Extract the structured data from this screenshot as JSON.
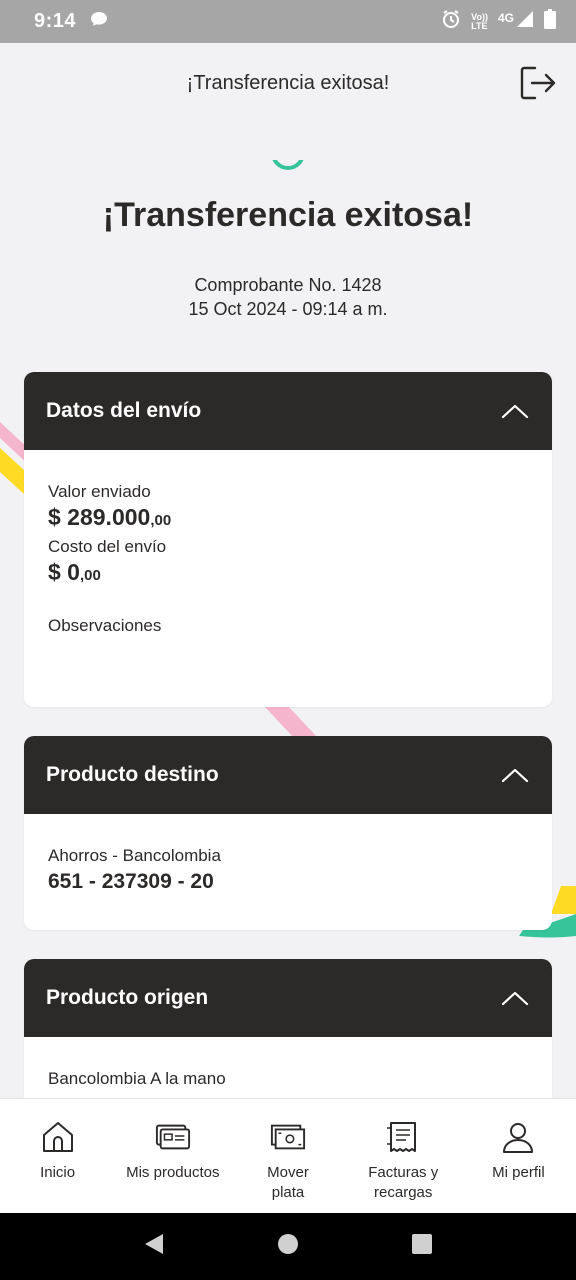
{
  "status_bar": {
    "time": "9:14",
    "volte_top": "Vo))",
    "volte_bottom": "LTE",
    "network": "4G"
  },
  "header": {
    "title": "¡Transferencia exitosa!"
  },
  "success": {
    "title": "¡Transferencia exitosa!",
    "receipt_line": "Comprobante No. 1428",
    "datetime": "15 Oct 2024 - 09:14 a m."
  },
  "envio": {
    "title": "Datos del envío",
    "valor_label": "Valor enviado",
    "valor_main": "$ 289.000",
    "valor_cents": ",00",
    "costo_label": "Costo del envío",
    "costo_main": "$ 0",
    "costo_cents": ",00",
    "observaciones_label": "Observaciones"
  },
  "destino": {
    "title": "Producto destino",
    "account_type": "Ahorros - Bancolombia",
    "account_number": "651 - 237309 - 20"
  },
  "origen": {
    "title": "Producto origen",
    "account_type": "Bancolombia A la mano"
  },
  "bottom_nav": {
    "items": [
      {
        "label": "Inicio",
        "icon": "home-icon"
      },
      {
        "label": "Mis productos",
        "icon": "card-icon"
      },
      {
        "label": "Mover plata",
        "icon": "money-icon"
      },
      {
        "label": "Facturas y recargas",
        "icon": "receipt-icon"
      },
      {
        "label": "Mi perfil",
        "icon": "user-icon"
      }
    ]
  },
  "colors": {
    "dark": "#2c2a29",
    "accent_green": "#36c49b",
    "accent_yellow": "#fdda24",
    "accent_pink": "#f5b6cd"
  }
}
